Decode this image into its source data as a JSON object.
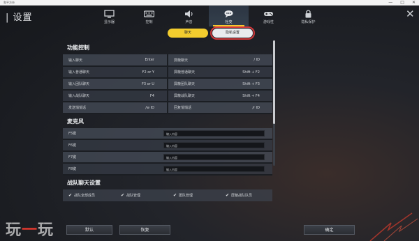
{
  "titlebar": {
    "app_title": "和平方舟",
    "min": "—",
    "max": "□",
    "close": "✕"
  },
  "header": {
    "title": "设置",
    "close_glyph": "✕"
  },
  "tabs": [
    {
      "label": "显示器",
      "icon": "monitor-icon"
    },
    {
      "label": "控制",
      "icon": "keyboard-icon"
    },
    {
      "label": "声音",
      "icon": "speaker-icon"
    },
    {
      "label": "社交",
      "icon": "chat-icon",
      "active": true
    },
    {
      "label": "游戏性",
      "icon": "gamepad-icon"
    },
    {
      "label": "隐私保护",
      "icon": "lock-icon"
    }
  ],
  "subtabs": {
    "chat": "聊天",
    "voice": "隐私设置"
  },
  "function_control": {
    "title": "功能控制",
    "rows": [
      [
        "输入聊天",
        "Enter",
        "屏蔽聊天",
        "/ ID"
      ],
      [
        "输入普通聊天",
        "F2 or Y",
        "屏蔽普通聊天",
        "Shift + F2"
      ],
      [
        "输入团队聊天",
        "F3 or U",
        "屏蔽团队聊天",
        "Shift + F3"
      ],
      [
        "输入战队聊天",
        "F4",
        "屏蔽战队聊天",
        "Shift + F4"
      ],
      [
        "发送悄悄话",
        "/w ID",
        "回复悄悄话",
        "/r ID"
      ]
    ]
  },
  "microphone": {
    "title": "麦克风",
    "rows": [
      {
        "key": "F5键",
        "value": "输入内容"
      },
      {
        "key": "F6键",
        "value": "输入内容"
      },
      {
        "key": "F7键",
        "value": "输入内容"
      },
      {
        "key": "F8键",
        "value": "输入内容"
      }
    ]
  },
  "team_chat": {
    "title": "战队聊天设置",
    "options": [
      "战队全部成员",
      "战队管理",
      "团队管理",
      "屏蔽战队队员"
    ]
  },
  "footer": {
    "default": "默认",
    "restore": "恢复",
    "confirm": "确定"
  },
  "watermark": {
    "part1": "玩",
    "dash": "一",
    "part2": "玩"
  },
  "colors": {
    "accent": "#f3cd2e",
    "highlight": "#d2383a"
  }
}
